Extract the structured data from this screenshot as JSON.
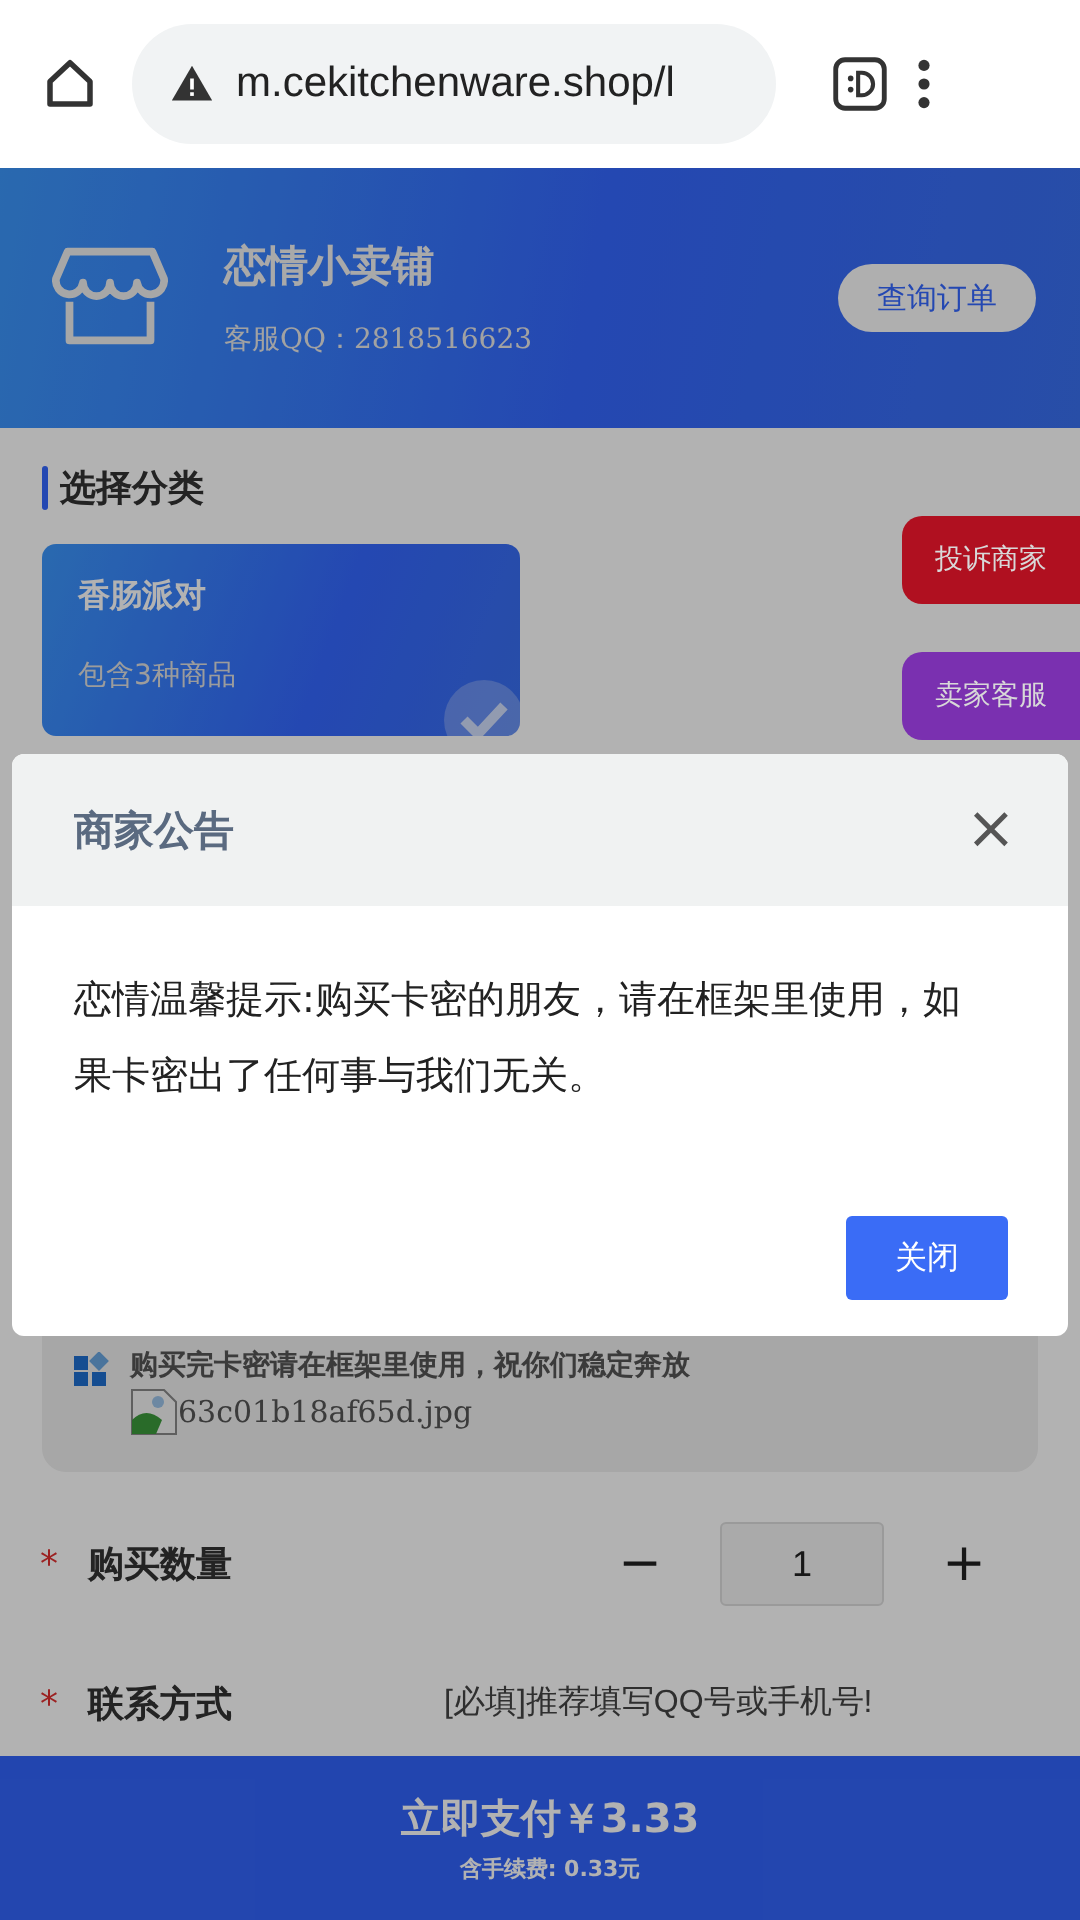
{
  "browser": {
    "url": "m.cekitchenware.shop/l"
  },
  "header": {
    "shop_name": "恋情小卖铺",
    "service_qq": "客服QQ：2818516623",
    "query_button": "查询订单"
  },
  "section_title": "选择分类",
  "categories": [
    {
      "name": "香肠派对",
      "subtitle": "包含3种商品",
      "selected": true
    }
  ],
  "float_buttons": [
    {
      "label": "投诉商家",
      "color": "#b01020"
    },
    {
      "label": "卖家客服",
      "color": "#7a30b0"
    }
  ],
  "notice": {
    "text": "购买完卡密请在框架里使用，祝你们稳定奔放",
    "image_alt": "63c01b18af65d.jpg"
  },
  "form": [
    {
      "kind": "stepper",
      "mark": "*",
      "label": "购买数量",
      "minus": "−",
      "value": "1",
      "plus": "+"
    },
    {
      "kind": "input",
      "mark": "*",
      "label": "联系方式",
      "placeholder": "[必填]推荐填写QQ号或手机号!"
    }
  ],
  "pay": {
    "label": "立即支付￥3.33",
    "fee": "含手续费: 0.33元"
  },
  "modal": {
    "title": "商家公告",
    "close_icon": "×",
    "body": "恋情温馨提示:购买卡密的朋友，请在框架里使用，如果卡密出了任何事与我们无关。",
    "button": "关闭"
  }
}
